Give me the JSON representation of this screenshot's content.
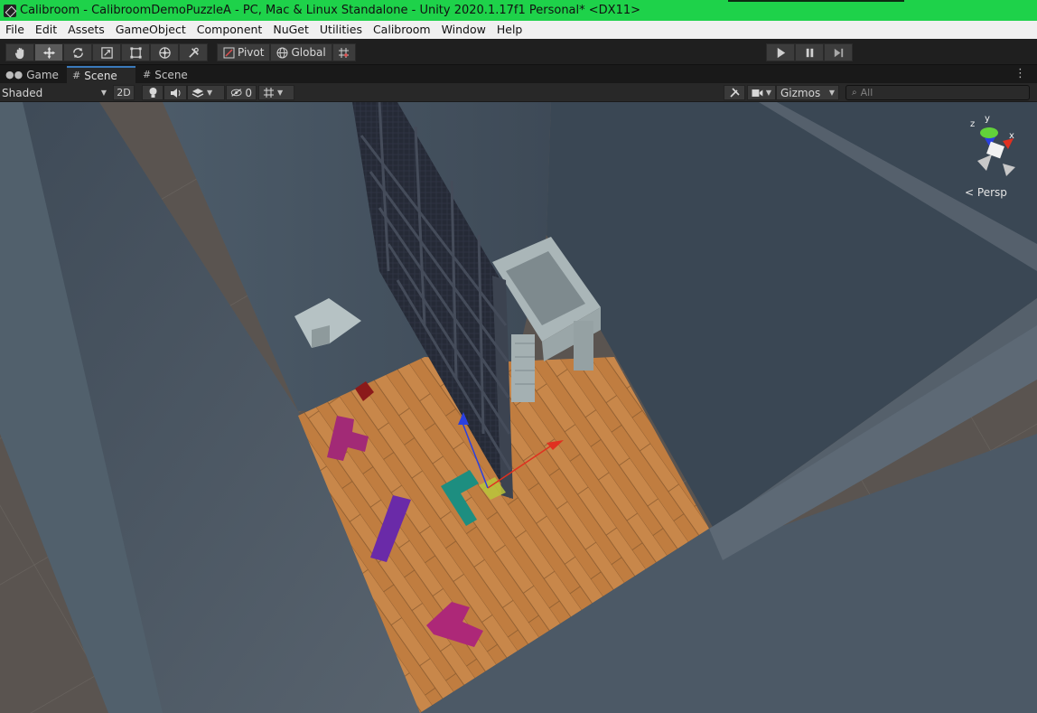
{
  "window": {
    "title": "Calibroom - CalibroomDemoPuzzleA - PC, Mac & Linux Standalone - Unity 2020.1.17f1 Personal* <DX11>"
  },
  "menu": [
    "File",
    "Edit",
    "Assets",
    "GameObject",
    "Component",
    "NuGet",
    "Utilities",
    "Calibroom",
    "Window",
    "Help"
  ],
  "toolbar": {
    "tools": [
      "hand-tool",
      "move-tool",
      "rotate-tool",
      "scale-tool",
      "rect-tool",
      "transform-tool",
      "custom-tool"
    ],
    "active_tool": "move-tool",
    "pivot_label": "Pivot",
    "global_label": "Global",
    "snap_icon": "grid-snap-icon",
    "play_controls": [
      "play-icon",
      "pause-icon",
      "step-icon"
    ]
  },
  "tabs": [
    {
      "label": "Game",
      "icon": "gamepad-icon",
      "active": false
    },
    {
      "label": "Scene",
      "icon": "grid-icon",
      "active": true
    },
    {
      "label": "Scene",
      "icon": "grid-icon",
      "active": false
    }
  ],
  "scene_toolbar": {
    "shading_mode": "Shaded",
    "toggle_2d": "2D",
    "hidden_count": "0",
    "gizmos_label": "Gizmos",
    "search_placeholder": "All"
  },
  "gizmo": {
    "axis_x": "x",
    "axis_y": "y",
    "axis_z": "z",
    "projection": "Persp"
  },
  "colors": {
    "title_bar": "#1ed24a",
    "wall": "#4c5966",
    "floor": "#c8874a",
    "outside_floor": "#5a5450",
    "selection_blue": "#3a79bb"
  }
}
